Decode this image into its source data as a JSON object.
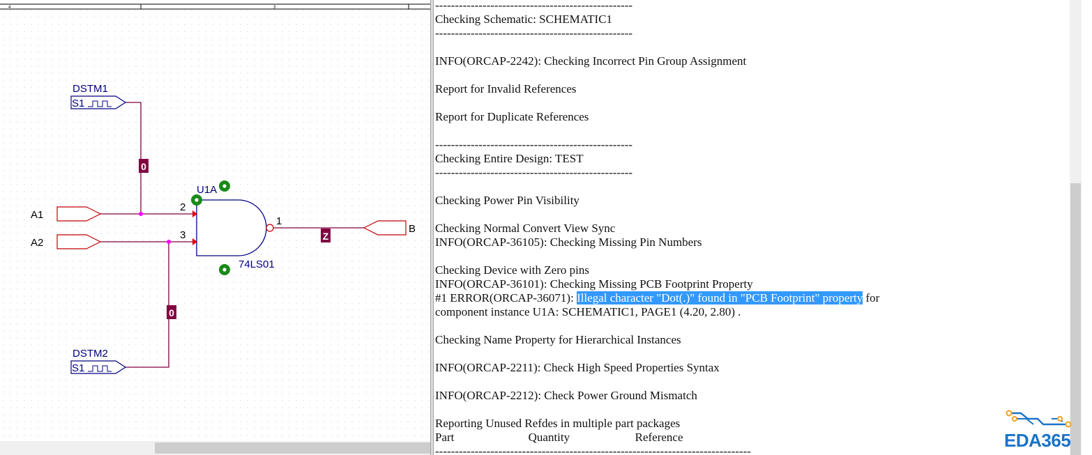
{
  "schematic": {
    "ruler": {
      "labels": [
        "4",
        "3"
      ]
    },
    "parts": {
      "dstm1": {
        "ref": "DSTM1",
        "value": "S1"
      },
      "dstm2": {
        "ref": "DSTM2",
        "value": "S1"
      },
      "gate": {
        "ref": "U1A",
        "value": "74LS01",
        "pin_in1": "2",
        "pin_in2": "3",
        "pin_out": "1"
      }
    },
    "ports": {
      "a1": "A1",
      "a2": "A2",
      "b": "B"
    },
    "net_aliases": {
      "top": "0",
      "bottom": "0",
      "output": "Z"
    },
    "colors": {
      "wire": "#800040",
      "part": "#000080",
      "port": "#c00000",
      "junction": "#ff00ff",
      "drc_marker": "#1a8a1a"
    }
  },
  "report": {
    "lines": [
      {
        "text": "--------------------------------------------------"
      },
      {
        "text": "Checking Schematic: SCHEMATIC1"
      },
      {
        "text": "--------------------------------------------------"
      },
      {
        "text": ""
      },
      {
        "text": "INFO(ORCAP-2242): Checking Incorrect Pin Group Assignment"
      },
      {
        "text": ""
      },
      {
        "text": "Report for Invalid References"
      },
      {
        "text": ""
      },
      {
        "text": "Report for Duplicate References"
      },
      {
        "text": ""
      },
      {
        "text": "--------------------------------------------------"
      },
      {
        "text": "Checking Entire Design: TEST"
      },
      {
        "text": "--------------------------------------------------"
      },
      {
        "text": ""
      },
      {
        "text": "Checking Power Pin Visibility"
      },
      {
        "text": ""
      },
      {
        "text": "Checking Normal Convert View Sync"
      },
      {
        "text": "INFO(ORCAP-36105): Checking Missing Pin Numbers"
      },
      {
        "text": ""
      },
      {
        "text": "Checking Device with Zero pins"
      },
      {
        "text": "INFO(ORCAP-36101): Checking Missing PCB Footprint Property"
      },
      {
        "text": "#1 ERROR(ORCAP-36071): ",
        "highlight": "Illegal character \"Dot(.)\" found in \"PCB Footprint\" property",
        "suffix": " for"
      },
      {
        "text": "component instance U1A: SCHEMATIC1, PAGE1 (4.20, 2.80) ."
      },
      {
        "text": ""
      },
      {
        "text": "Checking Name Property for Hierarchical Instances"
      },
      {
        "text": ""
      },
      {
        "text": "INFO(ORCAP-2211): Check High Speed Properties Syntax"
      },
      {
        "text": ""
      },
      {
        "text": "INFO(ORCAP-2212): Check Power Ground Mismatch"
      },
      {
        "text": ""
      },
      {
        "text": "Reporting Unused Refdes in multiple part packages"
      },
      {
        "text": "Part                         Quantity                      Reference"
      },
      {
        "text": "--------------------------------------------------------------------------------"
      }
    ]
  },
  "watermark": {
    "text": "EDA365",
    "color": "#1a73c8",
    "accent": "#f0a020"
  }
}
